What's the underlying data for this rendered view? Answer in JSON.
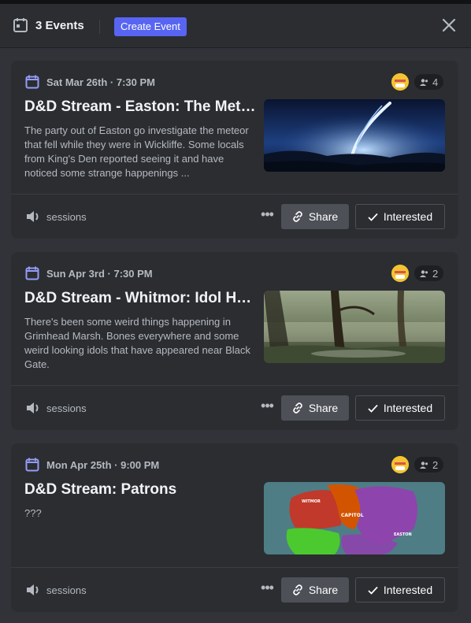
{
  "header": {
    "events_count": "3 Events",
    "create_label": "Create Event"
  },
  "events": [
    {
      "date": "Sat Mar 26th · 7:30 PM",
      "title": "D&D Stream - Easton: The Meteor",
      "description": "The party out of Easton go investigate the meteor that fell while they were in Wickliffe. Some locals from King's Den reported seeing it and have noticed some strange happenings ...",
      "interested_count": "4",
      "channel": "sessions",
      "share_label": "Share",
      "interested_label": "Interested",
      "image": "meteor-night-sky-image"
    },
    {
      "date": "Sun Apr 3rd · 7:30 PM",
      "title": "D&D Stream - Whitmor: Idol Hunt",
      "description": "There's been some weird things happening in Grimhead Marsh. Bones everywhere and some weird looking idols that have appeared near Black Gate.",
      "interested_count": "2",
      "channel": "sessions",
      "share_label": "Share",
      "interested_label": "Interested",
      "image": "misty-swamp-image"
    },
    {
      "date": "Mon Apr 25th · 9:00 PM",
      "title": "D&D Stream: Patrons",
      "description": "???",
      "interested_count": "2",
      "channel": "sessions",
      "share_label": "Share",
      "interested_label": "Interested",
      "image": "region-map-image",
      "map_labels": {
        "west": "WITMOR",
        "center": "CAPITOL",
        "east": "EASTON"
      }
    }
  ],
  "colors": {
    "accent": "#5865f2",
    "background": "#313338",
    "card": "#2b2d31",
    "calendar_icon": "#949cf7"
  }
}
